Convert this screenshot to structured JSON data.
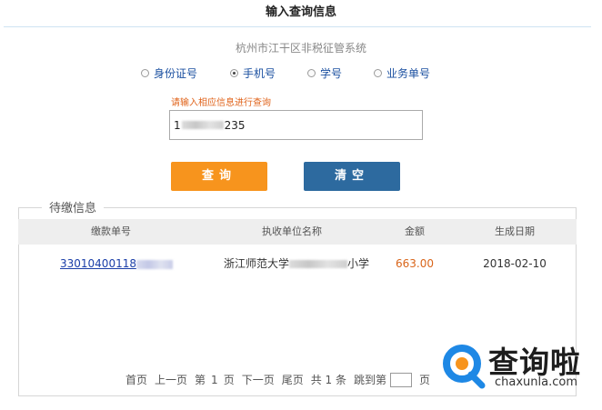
{
  "header": {
    "title": "输入查询信息"
  },
  "subtitle": "杭州市江干区非税征管系统",
  "radio_options": [
    {
      "label": "身份证号",
      "checked": false
    },
    {
      "label": "手机号",
      "checked": true
    },
    {
      "label": "学号",
      "checked": false
    },
    {
      "label": "业务单号",
      "checked": false
    }
  ],
  "hint": "请输入相应信息进行查询",
  "query_input": {
    "prefix": "1",
    "suffix": "235"
  },
  "buttons": {
    "query": "查询",
    "clear": "清空"
  },
  "section_title": "待缴信息",
  "table": {
    "headers": [
      "缴款单号",
      "执收单位名称",
      "金额",
      "生成日期"
    ],
    "row": {
      "order_no": "33010400118",
      "unit_prefix": "浙江师范大学",
      "unit_suffix": "小学",
      "amount": "663.00",
      "date": "2018-02-10"
    }
  },
  "pager": {
    "first": "首页",
    "prev": "上一页",
    "page_label_pre": "第",
    "page_num": "1",
    "page_label_post": "页",
    "next": "下一页",
    "last": "尾页",
    "total": "共 1 条",
    "jump_label": "跳到第",
    "jump_suffix": "页"
  },
  "watermark": {
    "brand": "查询啦",
    "url": "chaxunla.com"
  },
  "colors": {
    "accent_orange": "#f7941d",
    "accent_blue": "#2d6a9f",
    "link": "#1a3ea8",
    "amount": "#d9651a"
  }
}
